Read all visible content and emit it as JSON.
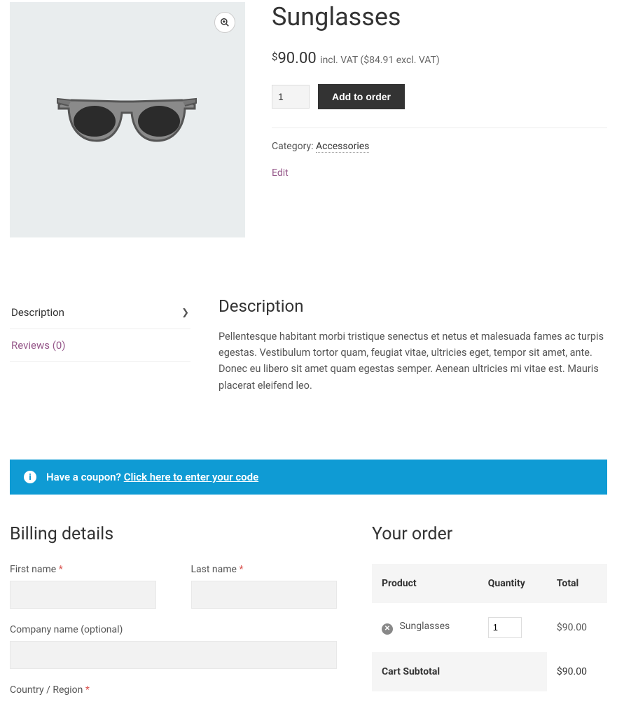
{
  "product": {
    "title": "Sunglasses",
    "currency": "$",
    "price": "90.00",
    "vat_label_incl": "incl. VAT",
    "price_excl": "$84.91",
    "vat_label_excl": "excl. VAT",
    "qty": "1",
    "add_label": "Add to order",
    "category_label": "Category:",
    "category": "Accessories",
    "edit": "Edit"
  },
  "tabs": {
    "description_label": "Description",
    "reviews_label": "Reviews (0)",
    "panel_heading": "Description",
    "panel_body": "Pellentesque habitant morbi tristique senectus et netus et malesuada fames ac turpis egestas. Vestibulum tortor quam, feugiat vitae, ultricies eget, tempor sit amet, ante. Donec eu libero sit amet quam egestas semper. Aenean ultricies mi vitae est. Mauris placerat eleifend leo."
  },
  "coupon": {
    "prompt": "Have a coupon?",
    "link": "Click here to enter your code"
  },
  "billing": {
    "heading": "Billing details",
    "first_name": "First name",
    "last_name": "Last name",
    "company": "Company name (optional)",
    "country": "Country / Region",
    "required_mark": "*"
  },
  "order": {
    "heading": "Your order",
    "col_product": "Product",
    "col_qty": "Quantity",
    "col_total": "Total",
    "item_name": "Sunglasses",
    "item_qty": "1",
    "item_total": "$90.00",
    "subtotal_label": "Cart Subtotal",
    "subtotal_value": "$90.00"
  }
}
